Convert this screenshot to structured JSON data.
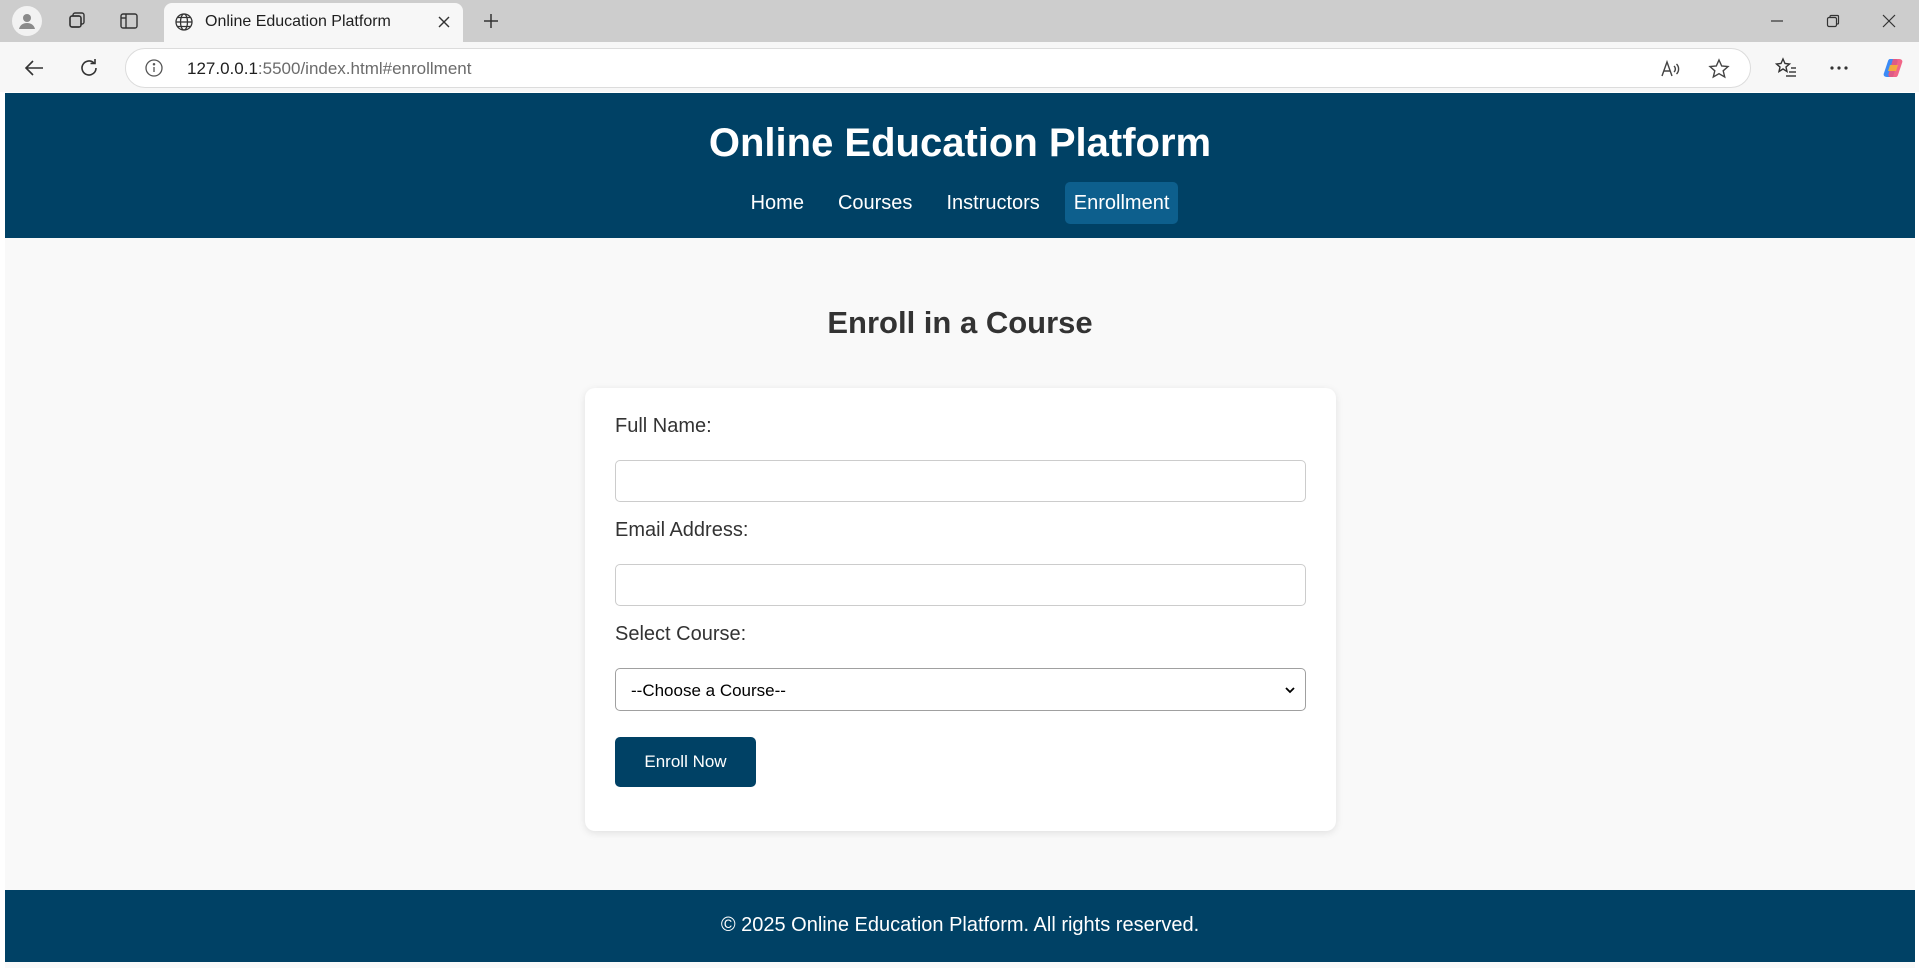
{
  "browser": {
    "tab_title": "Online Education Platform",
    "url_host": "127.0.0.1",
    "url_rest": ":5500/index.html#enrollment"
  },
  "site": {
    "title": "Online Education Platform",
    "nav": [
      {
        "label": "Home",
        "active": false
      },
      {
        "label": "Courses",
        "active": false
      },
      {
        "label": "Instructors",
        "active": false
      },
      {
        "label": "Enrollment",
        "active": true
      }
    ]
  },
  "enrollment": {
    "heading": "Enroll in a Course",
    "full_name_label": "Full Name:",
    "full_name_value": "",
    "email_label": "Email Address:",
    "email_value": "",
    "course_label": "Select Course:",
    "course_selected": "--Choose a Course--",
    "submit_label": "Enroll Now"
  },
  "footer": {
    "text": "© 2025 Online Education Platform. All rights reserved."
  },
  "colors": {
    "primary": "#004165",
    "nav_active": "#0d5f8d",
    "page_background": "#f9f9f9"
  }
}
